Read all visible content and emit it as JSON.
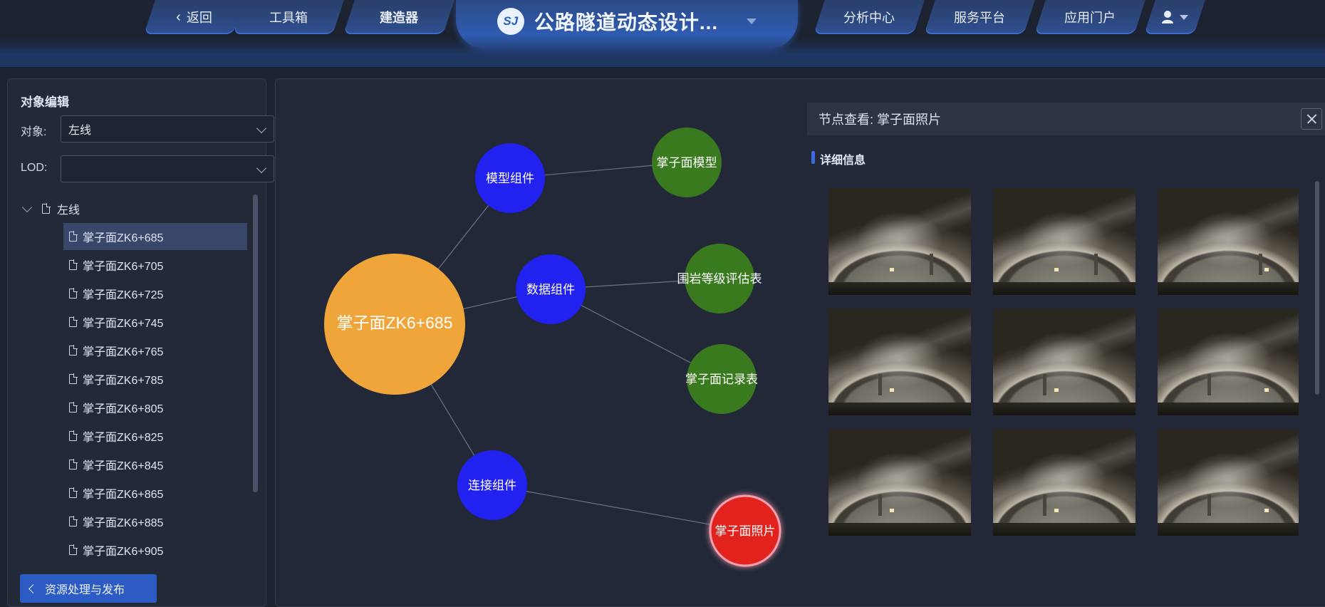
{
  "nav": {
    "back_label": "返回",
    "toolbox_label": "工具箱",
    "builder_label": "建造器",
    "app_title": "公路隧道动态设计...",
    "logo_text": "SJ",
    "analysis_label": "分析中心",
    "service_label": "服务平台",
    "portal_label": "应用门户"
  },
  "left_panel": {
    "title": "对象编辑",
    "object_label": "对象:",
    "object_value": "左线",
    "lod_label": "LOD:",
    "lod_value": "",
    "tree_root": "左线",
    "tree_items": [
      "掌子面ZK6+685",
      "掌子面ZK6+705",
      "掌子面ZK6+725",
      "掌子面ZK6+745",
      "掌子面ZK6+765",
      "掌子面ZK6+785",
      "掌子面ZK6+805",
      "掌子面ZK6+825",
      "掌子面ZK6+845",
      "掌子面ZK6+865",
      "掌子面ZK6+885",
      "掌子面ZK6+905"
    ],
    "selected_item": "掌子面ZK6+685",
    "bottom_button": "资源处理与发布"
  },
  "graph": {
    "nodes": [
      {
        "id": "root",
        "label": "掌子面ZK6+685",
        "kind": "root",
        "color": "#efa53a"
      },
      {
        "id": "model",
        "label": "模型组件",
        "kind": "group",
        "color": "#2121f0"
      },
      {
        "id": "data",
        "label": "数据组件",
        "kind": "group",
        "color": "#2121f0"
      },
      {
        "id": "link",
        "label": "连接组件",
        "kind": "group",
        "color": "#2121f0"
      },
      {
        "id": "face_model",
        "label": "掌子面模型",
        "kind": "leaf",
        "color": "#3a7a1e"
      },
      {
        "id": "rock_grade",
        "label": "围岩等级评估表",
        "kind": "leaf",
        "color": "#3a7a1e"
      },
      {
        "id": "face_record",
        "label": "掌子面记录表",
        "kind": "leaf",
        "color": "#3a7a1e"
      },
      {
        "id": "face_photo",
        "label": "掌子面照片",
        "kind": "selected",
        "color": "#e2231f"
      }
    ],
    "edges": [
      [
        "root",
        "model"
      ],
      [
        "root",
        "data"
      ],
      [
        "root",
        "link"
      ],
      [
        "model",
        "face_model"
      ],
      [
        "data",
        "rock_grade"
      ],
      [
        "data",
        "face_record"
      ],
      [
        "link",
        "face_photo"
      ]
    ]
  },
  "detail": {
    "header": "节点查看: 掌子面照片",
    "section_title": "详细信息",
    "photo_count": 9
  },
  "colors": {
    "accent": "#2d5bc4",
    "selected_node": "#e2231f",
    "root_node": "#efa53a",
    "group_node": "#2121f0",
    "leaf_node": "#3a7a1e"
  }
}
